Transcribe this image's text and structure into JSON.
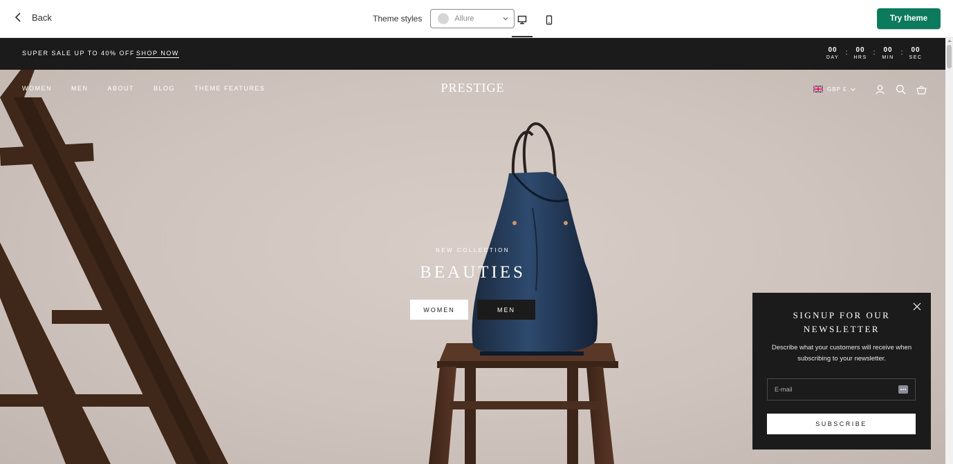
{
  "preview_bar": {
    "back_label": "Back",
    "theme_styles_label": "Theme styles",
    "selected_style": "Allure",
    "try_button_label": "Try theme",
    "colors": {
      "accent": "#0c7a5c",
      "text": "#303030"
    }
  },
  "announcement": {
    "text": "SUPER SALE UP TO 40% OFF",
    "link": "SHOP NOW",
    "countdown": [
      {
        "value": "00",
        "label": "DAY"
      },
      {
        "value": "00",
        "label": "HRS"
      },
      {
        "value": "00",
        "label": "MIN"
      },
      {
        "value": "00",
        "label": "SEC"
      }
    ],
    "separator": ":"
  },
  "header": {
    "nav": [
      "WOMEN",
      "MEN",
      "ABOUT",
      "BLOG",
      "THEME FEATURES"
    ],
    "logo": "PRESTIGE",
    "currency": "GBP £",
    "icons": [
      "account-icon",
      "search-icon",
      "cart-icon"
    ]
  },
  "hero": {
    "kicker": "NEW COLLECTION",
    "headline": "BEAUTIES",
    "buttons": [
      "WOMEN",
      "MEN"
    ]
  },
  "newsletter": {
    "title_line1": "SIGNUP FOR OUR",
    "title_line2": "NEWSLETTER",
    "description": "Describe what your customers will receive when subscribing to your newsletter.",
    "email_placeholder": "E-mail",
    "submit_label": "SUBSCRIBE"
  }
}
